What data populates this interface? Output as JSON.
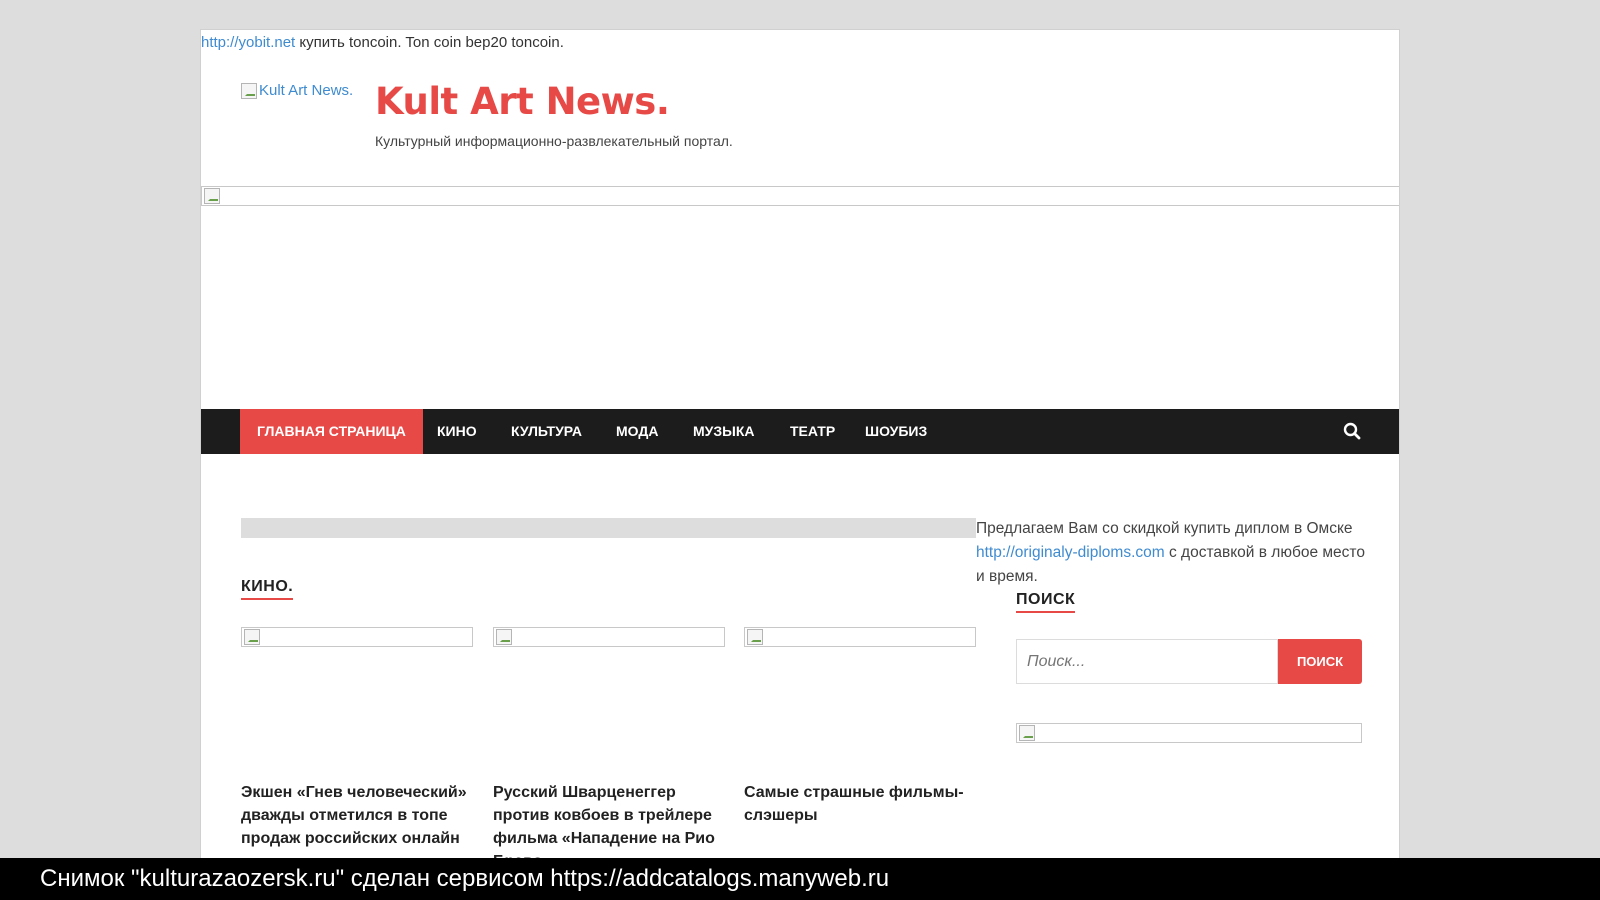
{
  "topline": {
    "link_text": "http://yobit.net",
    "rest_text": " купить toncoin. Ton coin bep20 toncoin."
  },
  "header": {
    "logo_alt": "Kult Art News.",
    "title": "Kult Art News.",
    "description": "Культурный информационно-развлекательный портал."
  },
  "nav": {
    "items": [
      {
        "label": "ГЛАВНАЯ СТРАНИЦА",
        "active": true
      },
      {
        "label": "КИНО"
      },
      {
        "label": "КУЛЬТУРА"
      },
      {
        "label": "МОДА"
      },
      {
        "label": "МУЗЫКА"
      },
      {
        "label": "ТЕАТР"
      },
      {
        "label": "ШОУБИЗ"
      }
    ],
    "search_icon": "search-icon"
  },
  "main": {
    "section_title": "КИНО.",
    "posts": [
      {
        "title": "Экшен «Гнев человеческий» дважды отметился в топе продаж российских онлайн"
      },
      {
        "title": "Русский Шварценеггер против ковбоев в трейлере фильма «Нападение на Рио Браво»"
      },
      {
        "title": "Самые страшные фильмы-слэшеры"
      }
    ]
  },
  "sidebar": {
    "text_before": "Предлагаем Вам со скидкой купить диплом в Омске ",
    "link_text": "http://originaly-diploms.com",
    "text_after": " с доставкой в любое место и время.",
    "search_heading": "ПОИСК",
    "search_placeholder": "Поиск...",
    "search_button": "ПОИСК"
  },
  "footer": {
    "text": "Снимок \"kulturazaozersk.ru\" сделан сервисом https://addcatalogs.manyweb.ru"
  },
  "colors": {
    "accent": "#e64946",
    "nav_bg": "#1c1c1c",
    "link": "#3f8bd0"
  }
}
